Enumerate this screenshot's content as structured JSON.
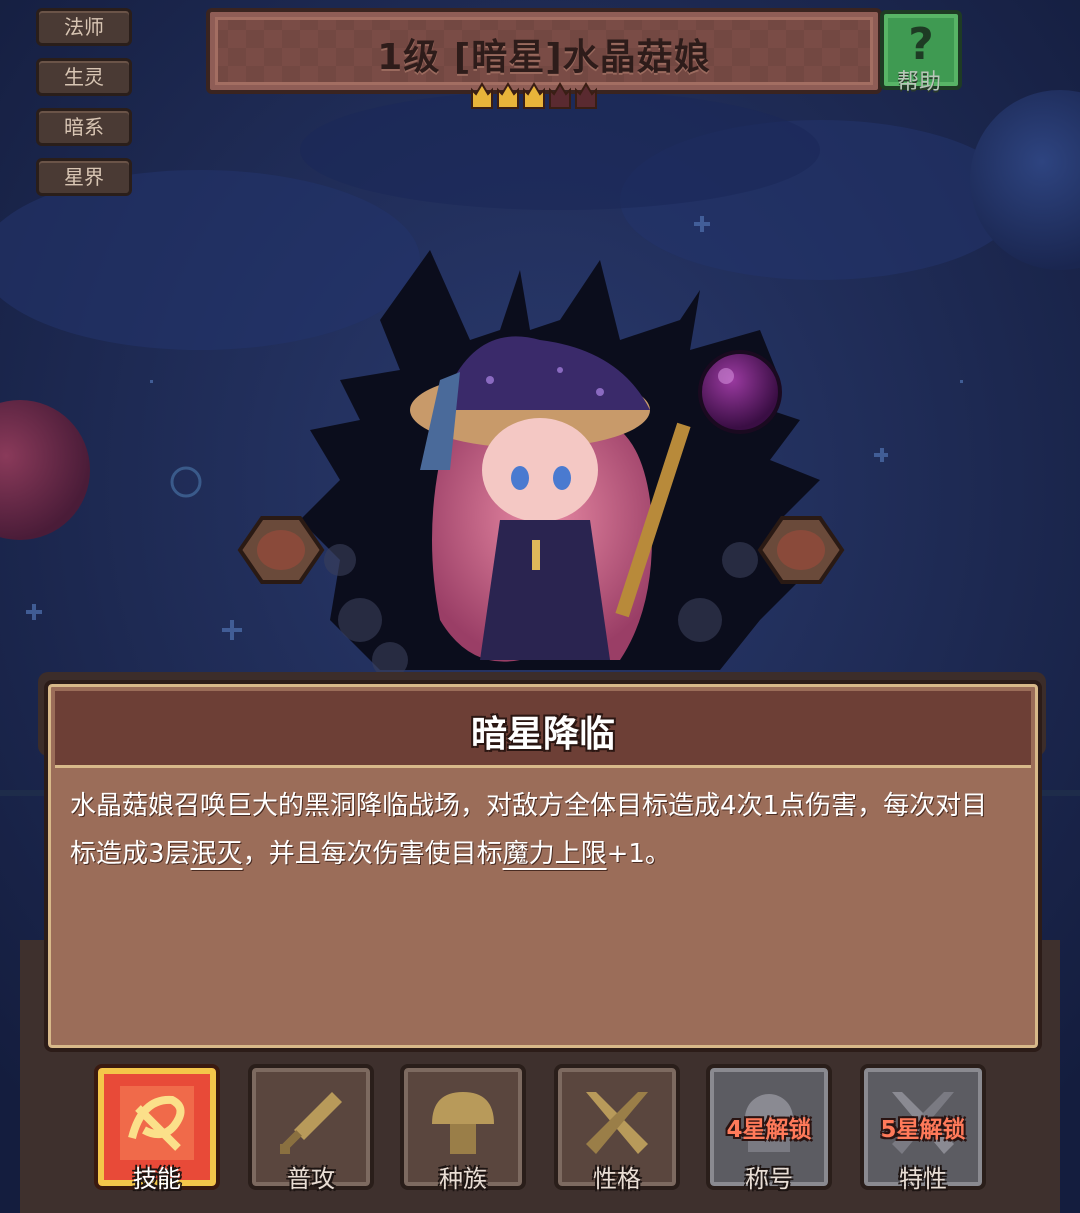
{
  "tags": [
    "法师",
    "生灵",
    "暗系",
    "星界"
  ],
  "header": {
    "title": "1级 [暗星]水晶菇娘",
    "stars_filled": 3,
    "stars_total": 5,
    "help_label": "帮助",
    "help_icon": "question-icon"
  },
  "skill": {
    "name": "暗星降临",
    "desc_1": "水晶菇娘召唤巨大的黑洞降临战场，对敌方全体目标造成4次1点伤害，每次对目标造成3层",
    "desc_keyword_1": "泯灭",
    "desc_2": "，并且每次伤害使目标",
    "desc_keyword_2": "魔力上限",
    "desc_3": "+1。"
  },
  "tabs": [
    {
      "label": "技能",
      "icon": "skill-icon",
      "state": "active"
    },
    {
      "label": "普攻",
      "icon": "sword-icon",
      "state": "normal"
    },
    {
      "label": "种族",
      "icon": "mushroom-icon",
      "state": "normal"
    },
    {
      "label": "性格",
      "icon": "crossed-swords-icon",
      "state": "normal"
    },
    {
      "label": "称号",
      "icon": "title-icon",
      "state": "locked",
      "lock_text": "4星解锁"
    },
    {
      "label": "特性",
      "icon": "trait-icon",
      "state": "locked",
      "lock_text": "5星解锁"
    }
  ],
  "colors": {
    "background": "#1b2750",
    "panel": "#9b6d59",
    "panel_header": "#6d3f36",
    "star_filled": "#e8b43a",
    "star_empty": "#5a2a30",
    "active_tab": "#e84a38",
    "lock_text": "#ff7a5a"
  }
}
